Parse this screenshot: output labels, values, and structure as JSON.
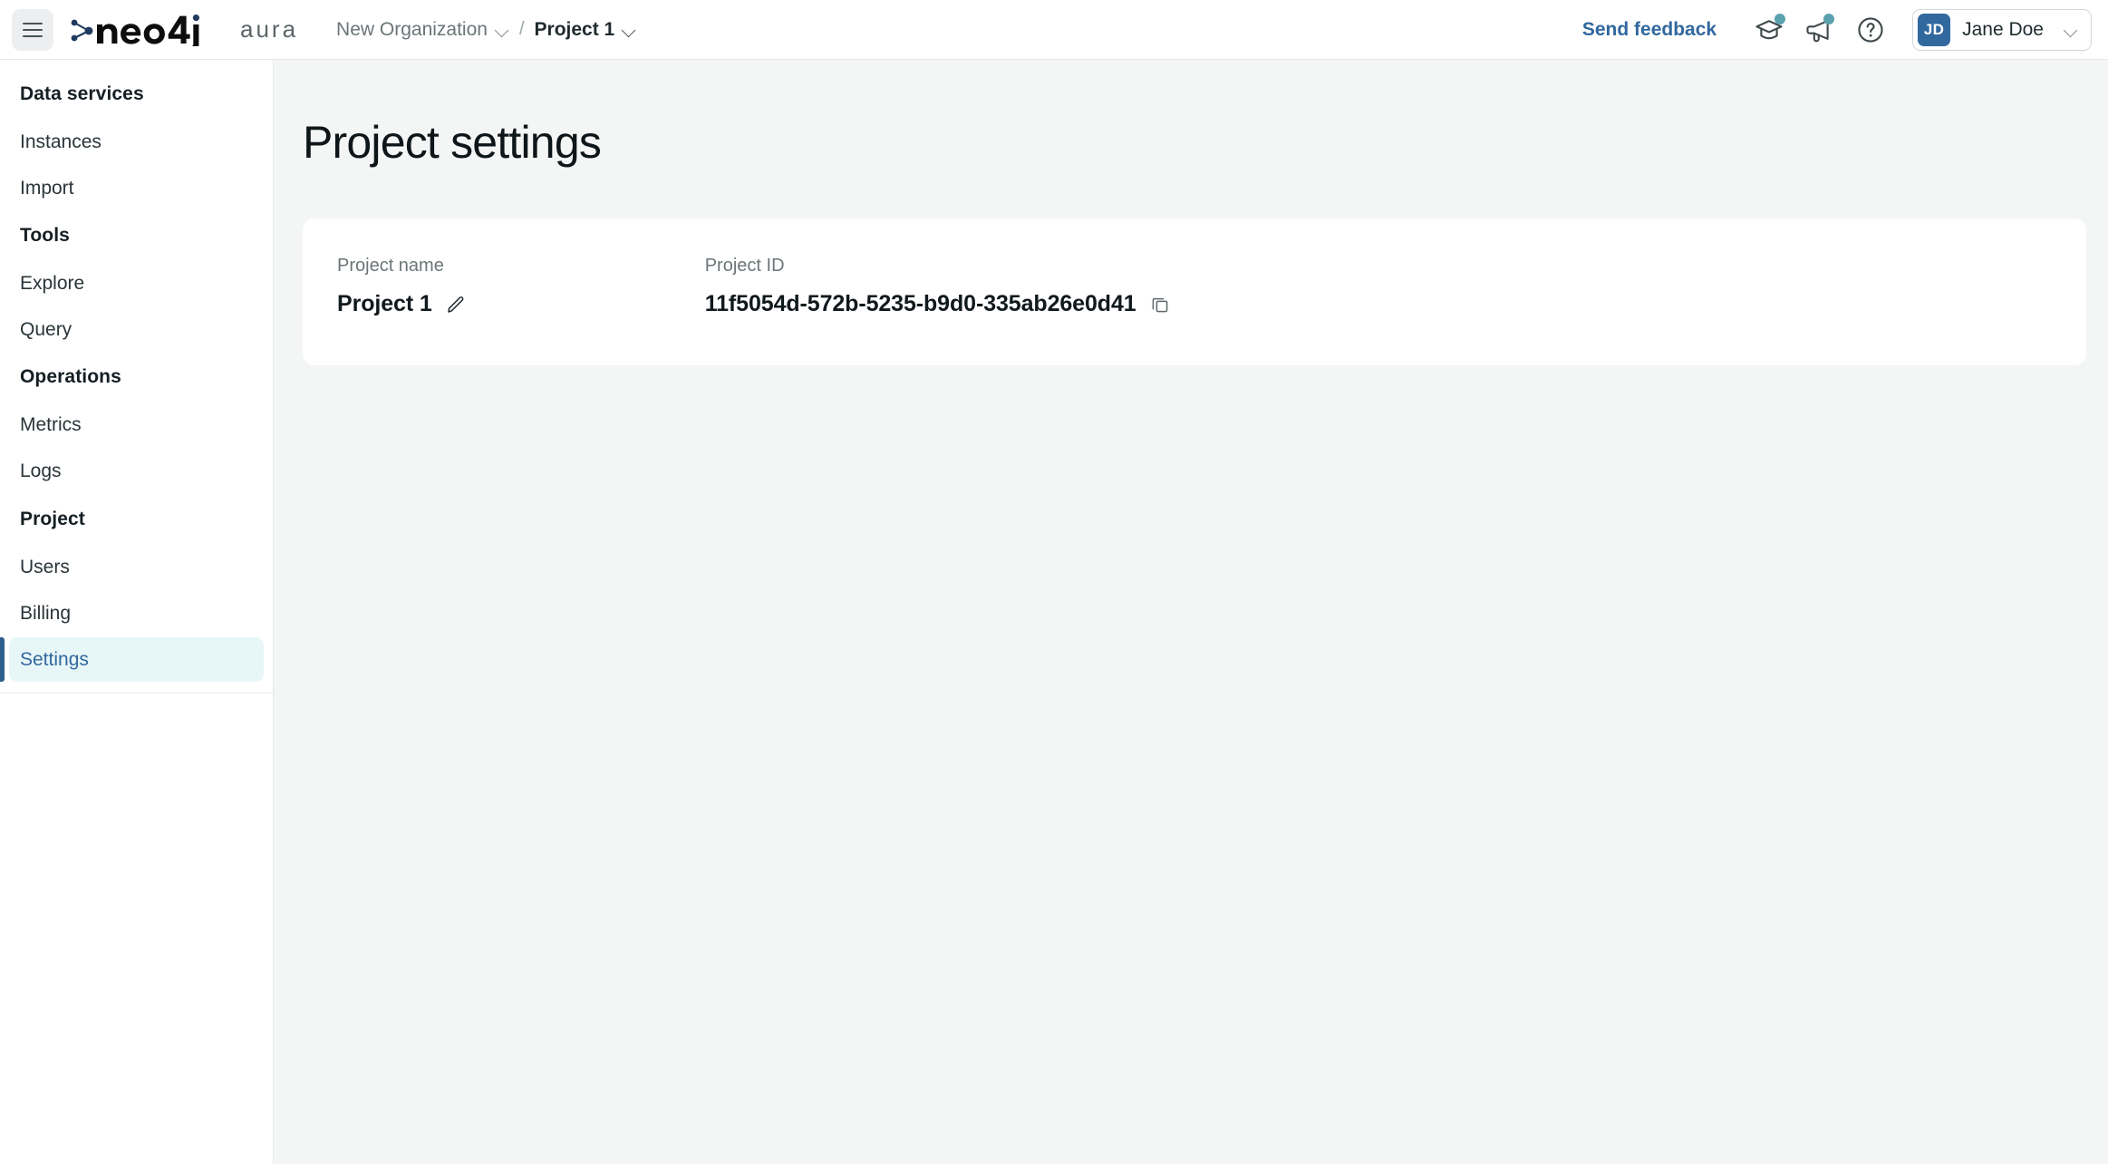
{
  "topbar": {
    "menu_icon": "hamburger-icon",
    "logo_text": "neo4j",
    "logo_suffix": "aura",
    "breadcrumb": {
      "org": "New Organization",
      "separator": "/",
      "project": "Project 1"
    },
    "send_feedback": "Send feedback",
    "icons": [
      {
        "name": "graduation-cap-icon",
        "has_badge": true
      },
      {
        "name": "megaphone-icon",
        "has_badge": true
      },
      {
        "name": "help-circle-icon",
        "has_badge": false
      }
    ],
    "user": {
      "initials": "JD",
      "name": "Jane Doe"
    }
  },
  "sidebar": {
    "sections": [
      {
        "heading": "Data services",
        "items": [
          {
            "label": "Instances",
            "active": false
          },
          {
            "label": "Import",
            "active": false
          }
        ]
      },
      {
        "heading": "Tools",
        "items": [
          {
            "label": "Explore",
            "active": false
          },
          {
            "label": "Query",
            "active": false
          }
        ]
      },
      {
        "heading": "Operations",
        "items": [
          {
            "label": "Metrics",
            "active": false
          },
          {
            "label": "Logs",
            "active": false
          }
        ]
      },
      {
        "heading": "Project",
        "items": [
          {
            "label": "Users",
            "active": false
          },
          {
            "label": "Billing",
            "active": false
          },
          {
            "label": "Settings",
            "active": true
          }
        ]
      }
    ]
  },
  "main": {
    "page_title": "Project settings",
    "card": {
      "project_name_label": "Project name",
      "project_name_value": "Project 1",
      "edit_icon": "pencil-icon",
      "project_id_label": "Project ID",
      "project_id_value": "11f5054d-572b-5235-b9d0-335ab26e0d41",
      "copy_icon": "copy-icon"
    }
  },
  "colors": {
    "accent_blue": "#31689e",
    "active_nav_bg": "#e7f6f7",
    "active_nav_border": "#2e5f8c",
    "badge_teal": "#5aa0ad",
    "page_bg": "#f4f5f5"
  }
}
